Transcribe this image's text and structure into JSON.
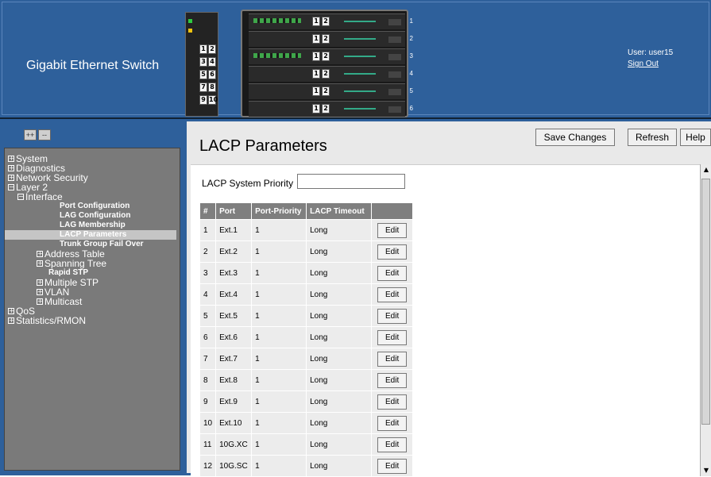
{
  "header": {
    "title": "Gigabit Ethernet Switch",
    "user_label": "User: user15",
    "signout_label": "Sign Out",
    "front_panel_ports": [
      "1",
      "2",
      "3",
      "4",
      "5",
      "6",
      "7",
      "8",
      "9",
      "10"
    ],
    "chassis_bay_numbers": [
      "1",
      "2",
      "3",
      "4",
      "5",
      "6"
    ],
    "chassis_blade_buttons": [
      "1",
      "2"
    ]
  },
  "sidebar": {
    "expand_all_label": "++",
    "collapse_all_label": "--",
    "tree": [
      {
        "label": "System",
        "expander": "+",
        "level": 0
      },
      {
        "label": "Diagnostics",
        "expander": "+",
        "level": 0
      },
      {
        "label": "Network Security",
        "expander": "+",
        "level": 0
      },
      {
        "label": "Layer 2",
        "expander": "−",
        "level": 0
      },
      {
        "label": "Interface",
        "expander": "−",
        "level": 1
      },
      {
        "label": "Port Configuration",
        "expander": "",
        "level": 2
      },
      {
        "label": "LAG Configuration",
        "expander": "",
        "level": 2
      },
      {
        "label": "LAG Membership",
        "expander": "",
        "level": 2
      },
      {
        "label": "LACP Parameters",
        "expander": "",
        "level": 2,
        "selected": true
      },
      {
        "label": "Trunk Group Fail Over",
        "expander": "",
        "level": 2
      },
      {
        "label": "Address Table",
        "expander": "+",
        "level": 1
      },
      {
        "label": "Spanning Tree",
        "expander": "+",
        "level": 1
      },
      {
        "label": "Rapid STP",
        "expander": "",
        "level": 1.5
      },
      {
        "label": "Multiple STP",
        "expander": "+",
        "level": 1
      },
      {
        "label": "VLAN",
        "expander": "+",
        "level": 1
      },
      {
        "label": "Multicast",
        "expander": "+",
        "level": 1
      },
      {
        "label": "QoS",
        "expander": "+",
        "level": 0
      },
      {
        "label": "Statistics/RMON",
        "expander": "+",
        "level": 0
      }
    ]
  },
  "main": {
    "page_title": "LACP Parameters",
    "toolbar": {
      "save_label": "Save Changes",
      "refresh_label": "Refresh",
      "help_label": "Help"
    },
    "system_priority_label": "LACP System Priority",
    "system_priority_value": "",
    "table": {
      "headers": [
        "#",
        "Port",
        "Port-Priority",
        "LACP Timeout",
        ""
      ],
      "edit_label": "Edit",
      "rows": [
        [
          "1",
          "Ext.1",
          "1",
          "Long"
        ],
        [
          "2",
          "Ext.2",
          "1",
          "Long"
        ],
        [
          "3",
          "Ext.3",
          "1",
          "Long"
        ],
        [
          "4",
          "Ext.4",
          "1",
          "Long"
        ],
        [
          "5",
          "Ext.5",
          "1",
          "Long"
        ],
        [
          "6",
          "Ext.6",
          "1",
          "Long"
        ],
        [
          "7",
          "Ext.7",
          "1",
          "Long"
        ],
        [
          "8",
          "Ext.8",
          "1",
          "Long"
        ],
        [
          "9",
          "Ext.9",
          "1",
          "Long"
        ],
        [
          "10",
          "Ext.10",
          "1",
          "Long"
        ],
        [
          "11",
          "10G.XC",
          "1",
          "Long"
        ],
        [
          "12",
          "10G.SC",
          "1",
          "Long"
        ]
      ]
    }
  },
  "colors": {
    "frame_blue": "#2e609b",
    "tree_panel": "#7a7a7a",
    "table_header": "#7f7f7f",
    "content_bg": "#e9e9e9"
  }
}
